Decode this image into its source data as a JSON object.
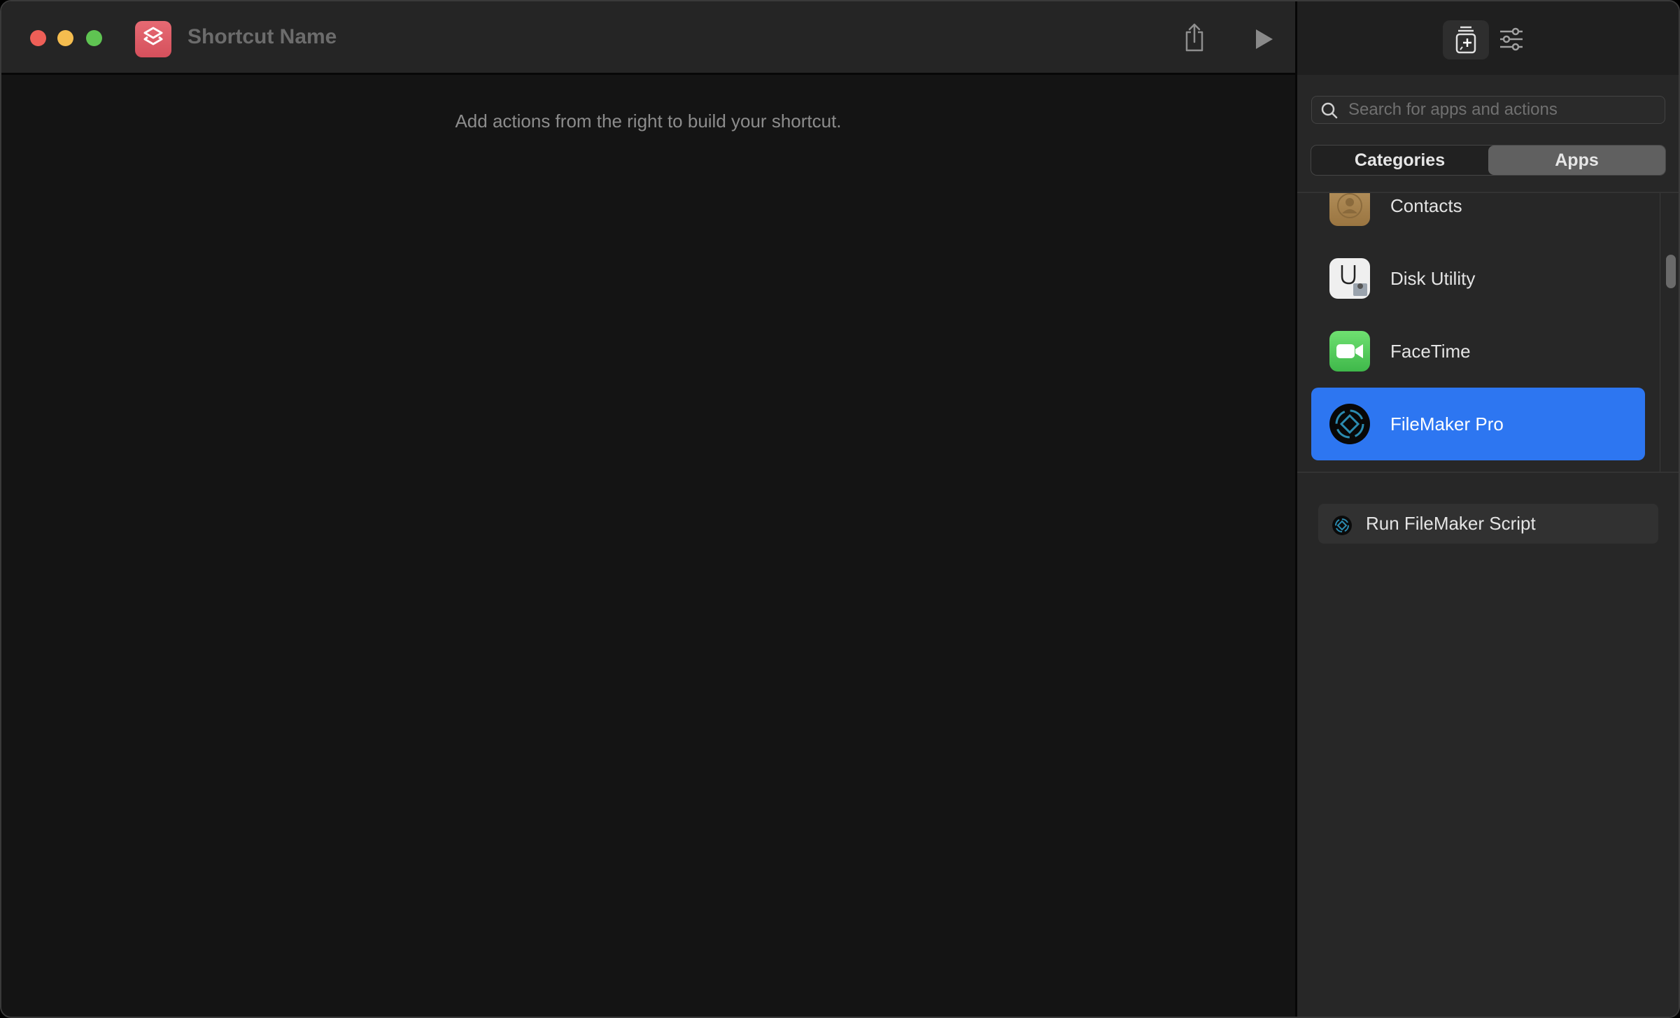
{
  "window": {
    "title": "Shortcut Name",
    "empty_hint": "Add actions from the right to build your shortcut."
  },
  "toolbar": {
    "share_icon": "share-icon",
    "run_icon": "play-icon"
  },
  "library": {
    "tabs": [
      {
        "name": "action-library",
        "icon": "action-library-icon",
        "active": true
      },
      {
        "name": "shortcut-details",
        "icon": "sliders-icon",
        "active": false
      }
    ],
    "search": {
      "placeholder": "Search for apps and actions",
      "value": ""
    },
    "segments": [
      {
        "label": "Categories",
        "active": false
      },
      {
        "label": "Apps",
        "active": true
      }
    ],
    "apps": [
      {
        "label": "Contacts",
        "icon": "contacts-app-icon",
        "selected": false
      },
      {
        "label": "Disk Utility",
        "icon": "disk-utility-app-icon",
        "selected": false
      },
      {
        "label": "FaceTime",
        "icon": "facetime-app-icon",
        "selected": false
      },
      {
        "label": "FileMaker Pro",
        "icon": "filemaker-pro-app-icon",
        "selected": true
      }
    ],
    "actions": [
      {
        "label": "Run FileMaker Script",
        "icon": "filemaker-pro-icon"
      }
    ]
  },
  "colors": {
    "accent": "#2d76f1",
    "close": "#ee5f57",
    "minimize": "#f5bd4f",
    "maximize": "#5fc452",
    "app_icon": "#dc5a64"
  }
}
